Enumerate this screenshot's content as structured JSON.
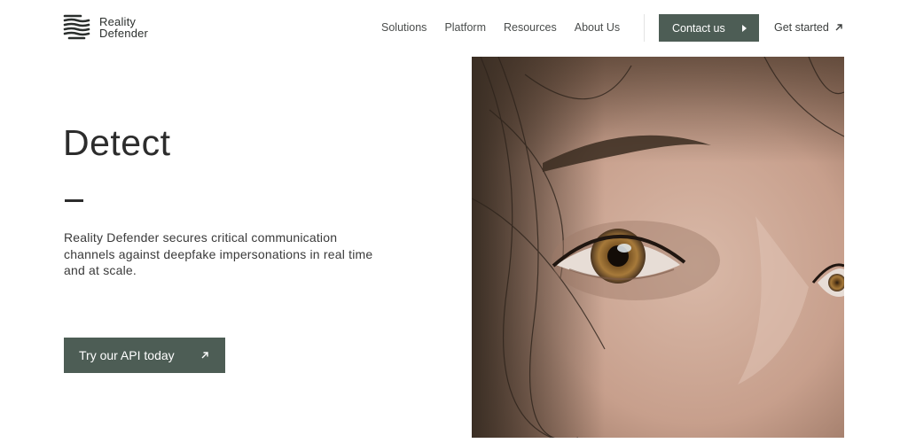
{
  "header": {
    "brand_line1": "Reality",
    "brand_line2": "Defender",
    "nav": [
      "Solutions",
      "Platform",
      "Resources",
      "About Us"
    ],
    "contact_label": "Contact us",
    "get_started_label": "Get started"
  },
  "hero": {
    "title": "Detect",
    "description": "Reality Defender secures critical communication channels against deepfake impersonations in real time and at scale.",
    "cta_label": "Try our API today"
  },
  "colors": {
    "accent": "#4d5d55",
    "text": "#2c2c2c"
  },
  "icons": {
    "logo": "stacked-waves-logo",
    "contact": "caret-right-icon",
    "get_started": "arrow-up-right-icon",
    "cta": "arrow-up-right-icon"
  }
}
